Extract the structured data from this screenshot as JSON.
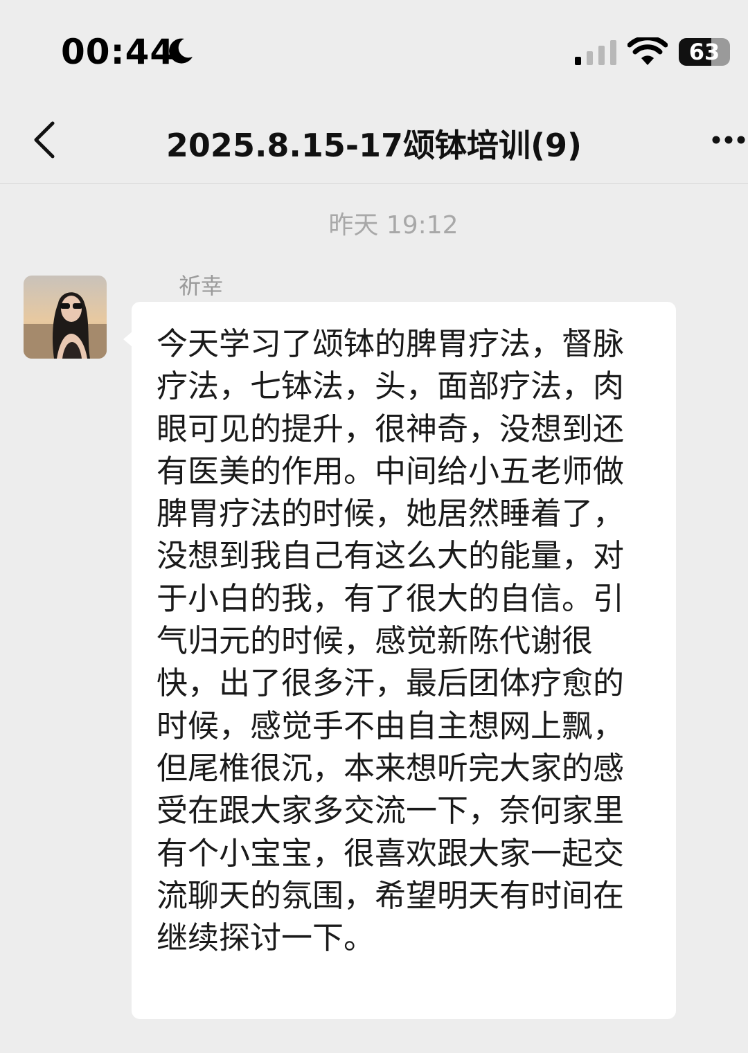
{
  "status_bar": {
    "time": "00:44",
    "focus_mode_icon": "moon-icon",
    "signal_icon": "cellular-signal-icon",
    "wifi_icon": "wifi-icon",
    "battery_level": "63"
  },
  "nav": {
    "back_icon": "chevron-left-icon",
    "title": "2025.8.15-17颂钵培训(9)",
    "more_icon": "more-dots-icon"
  },
  "chat": {
    "timestamp": "昨天 19:12",
    "message": {
      "sender_name": "祈幸",
      "text": "今天学习了颂钵的脾胃疗法，督脉疗法，七钵法，头，面部疗法，肉眼可见的提升，很神奇，没想到还有医美的作用。中间给小五老师做脾胃疗法的时候，她居然睡着了，没想到我自己有这么大的能量，对于小白的我，有了很大的自信。引气归元的时候，感觉新陈代谢很快，出了很多汗，最后团体疗愈的时候，感觉手不由自主想网上飘，但尾椎很沉，本来想听完大家的感受在跟大家多交流一下，奈何家里有个小宝宝，很喜欢跟大家一起交流聊天的氛围，希望明天有时间在继续探讨一下。"
    }
  },
  "colors": {
    "background": "#ededed",
    "bubble": "#ffffff",
    "timestamp_text": "#a8a8a8"
  }
}
